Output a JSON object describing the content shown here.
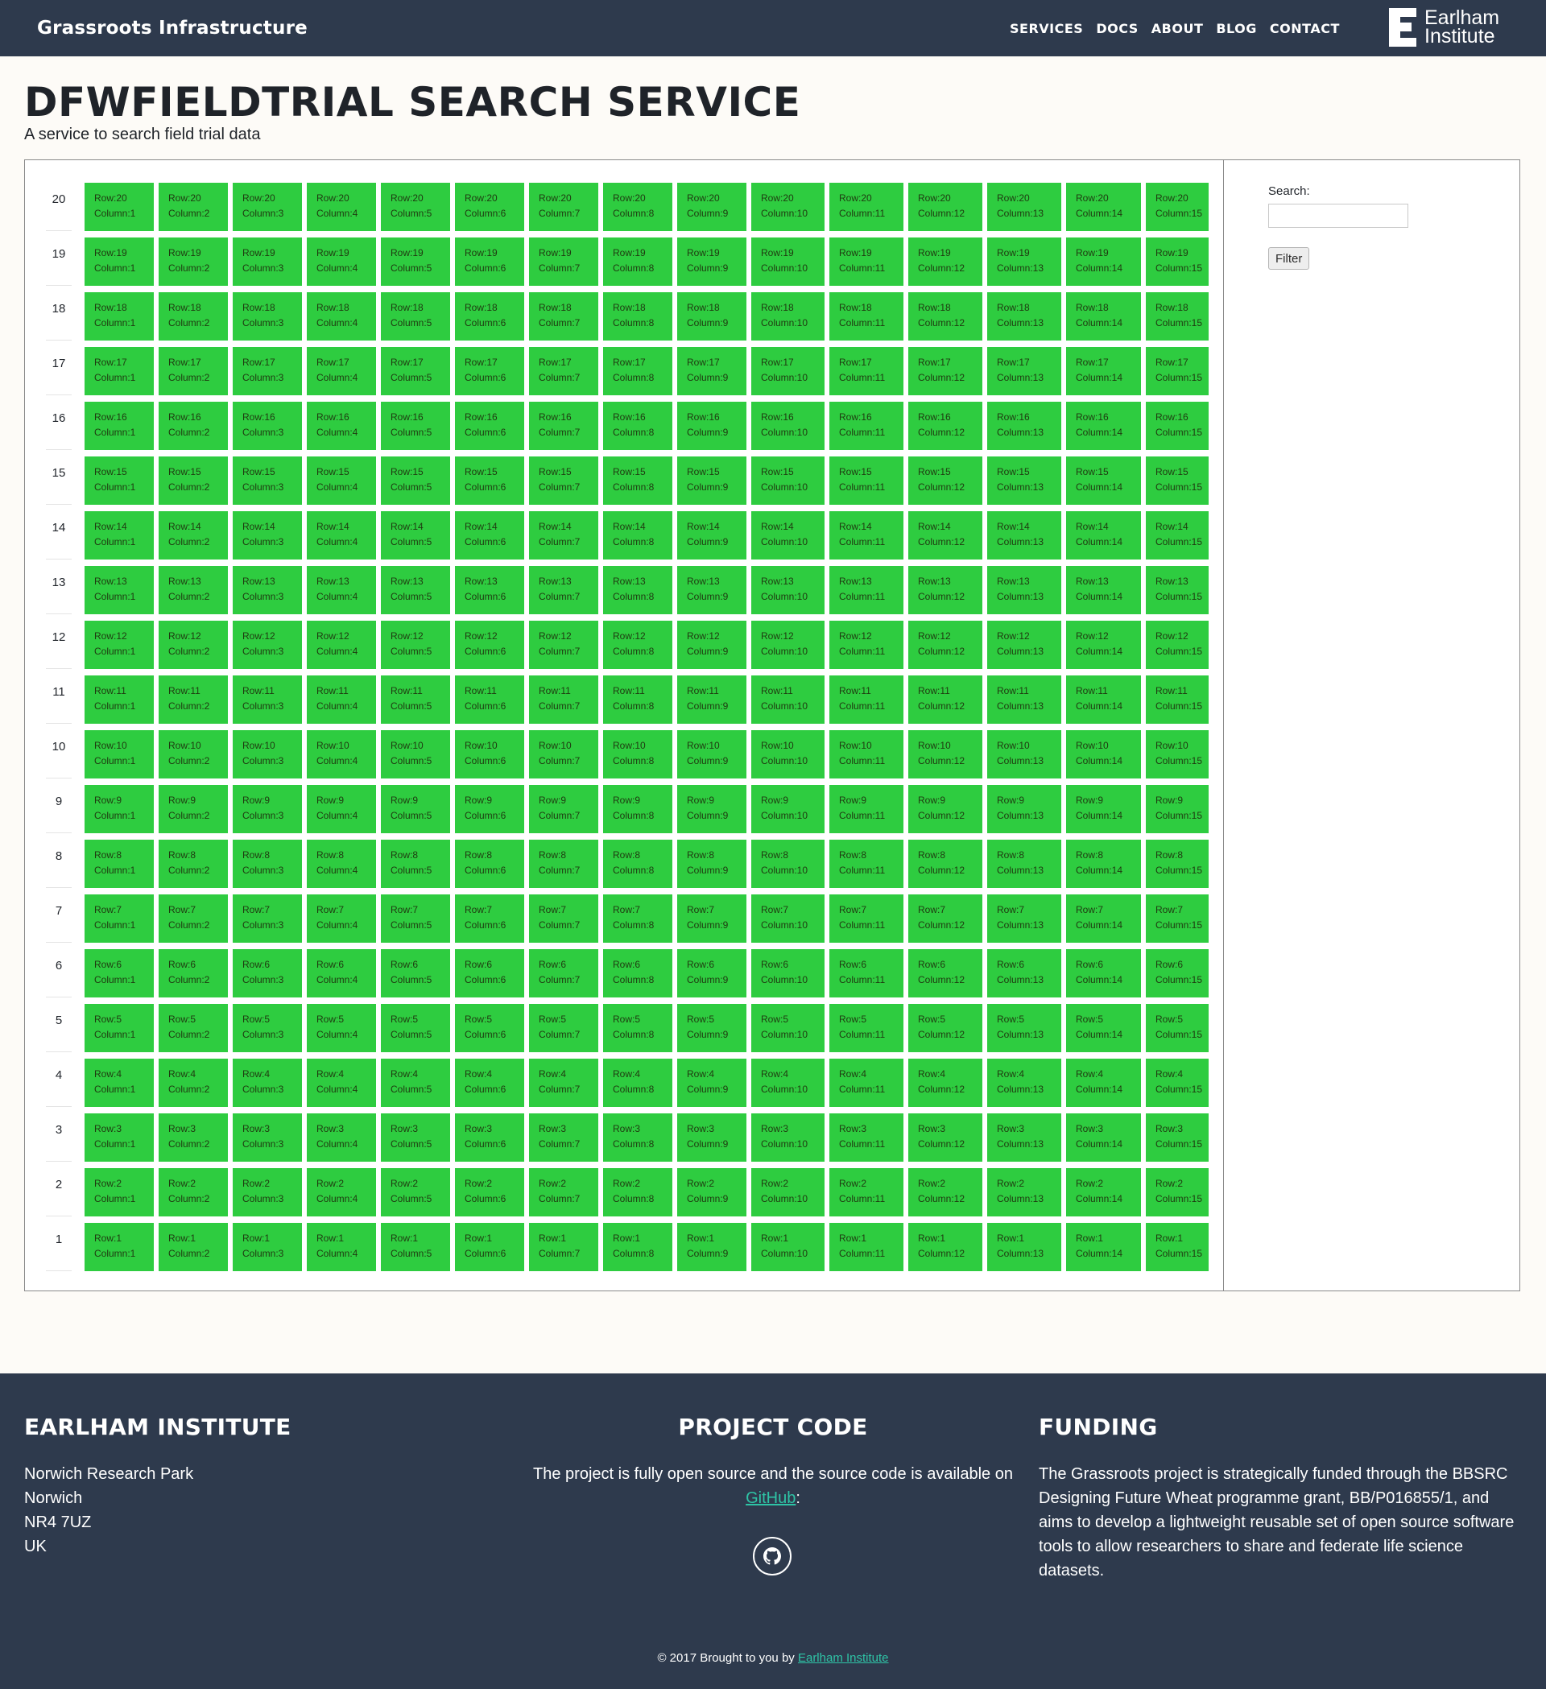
{
  "header": {
    "brand": "Grassroots Infrastructure",
    "nav": [
      "SERVICES",
      "DOCS",
      "ABOUT",
      "BLOG",
      "CONTACT"
    ],
    "logo_line1": "Earlham",
    "logo_line2": "Institute"
  },
  "page": {
    "title": "DFWFIELDTRIAL SEARCH SERVICE",
    "subtitle": "A service to search field trial data"
  },
  "plot_grid": {
    "row_labels": [
      "20",
      "19",
      "18",
      "17",
      "16",
      "15",
      "14",
      "13",
      "12",
      "11",
      "10",
      "9",
      "8",
      "7",
      "6",
      "5",
      "4",
      "3",
      "2",
      "1"
    ],
    "column_count": 15,
    "cell_color": "#2ecc40",
    "cell_row_prefix": "Row:",
    "cell_column_prefix": "Column:"
  },
  "search": {
    "label": "Search:",
    "value": "",
    "button_label": "Filter"
  },
  "footer": {
    "col1_title": "EARLHAM INSTITUTE",
    "address": [
      "Norwich Research Park",
      "Norwich",
      "NR4 7UZ",
      "UK"
    ],
    "col2_title": "PROJECT CODE",
    "project_text": "The project is fully open source and the source code is available on",
    "github_link": "GitHub",
    "github_suffix": ":",
    "col3_title": "FUNDING",
    "funding_text": "The Grassroots project is strategically funded through the BBSRC Designing Future Wheat programme grant, BB/P016855/1, and aims to develop a lightweight reusable set of open source software tools to allow researchers to share and federate life science datasets.",
    "copyright_prefix": "© 2017 Brought to you by",
    "copyright_link": "Earlham Institute"
  },
  "colors": {
    "header_bg": "#2e3a4d",
    "footer_bg": "#2e3a4d",
    "link": "#2ec4a6",
    "cell_green": "#2ecc40"
  }
}
